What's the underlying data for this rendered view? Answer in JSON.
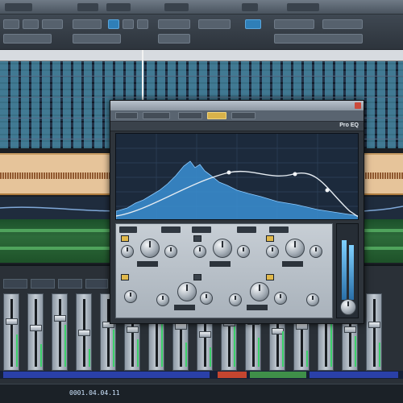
{
  "colors": {
    "accent": "#2f7fb8",
    "eq_curve": "#e6ecf2",
    "spectrum": "#3a8fd4",
    "audio_clip": "#e6c49a",
    "green_track": "#2d6b3a",
    "plugin_highlight": "#d8b24a"
  },
  "icons": [
    "close-icon"
  ],
  "ruler": {
    "ticks": [
      "",
      "",
      "",
      "",
      "",
      "",
      "",
      ""
    ]
  },
  "plugin": {
    "logo": "Pro EQ"
  },
  "mixer": {
    "channel_count": 16
  },
  "status": {
    "time": "0001.04.04.11"
  }
}
